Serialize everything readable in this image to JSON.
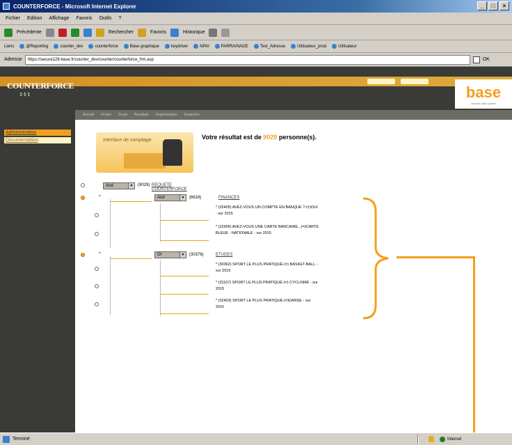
{
  "window": {
    "title": "COUNTERFORCE - Microsoft Internet Explorer"
  },
  "menu": [
    "Fichier",
    "Edition",
    "Affichage",
    "Favoris",
    "Outils",
    "?"
  ],
  "toolbar": {
    "back": "Précédente",
    "search": "Rechercher",
    "favorites": "Favoris",
    "history": "Historique"
  },
  "links": {
    "label": "Liens",
    "items": [
      "@Reporting",
      "counter_dev",
      "counterforce",
      "Base graphique",
      "keydriver",
      "NPAI",
      "PARRAINAGE",
      "Test_Adresse",
      "Utilisateur_prod",
      "Utilisateur"
    ]
  },
  "address": {
    "label": "Adresse",
    "url": "https://secure128-base.fr/counter_dev/counter/counterforce_frm.asp",
    "go": "OK"
  },
  "header": {
    "brand": "COUNTERFORCE",
    "brand_sub": "1·1·1",
    "base_logo": "base",
    "base_tagline": "courrier data system"
  },
  "nav": [
    "Accueil",
    "Fichier",
    "Script",
    "Resultats",
    "Segmentation",
    "Extraction"
  ],
  "sidebar": {
    "items": [
      "Administration",
      "Documentation"
    ]
  },
  "illustration": {
    "label": "Interface de comptage"
  },
  "result": {
    "prefix": "Votre résultat est de",
    "count": "9029",
    "suffix": "personne(s)."
  },
  "tree": {
    "root": {
      "op": "And",
      "count": "(9029)",
      "label": "REQUETE COUNTERFORCE"
    },
    "groups": [
      {
        "op": "And",
        "count": "(6618)",
        "label": "FINANCES",
        "criteria": [
          "* (32405) AVEZ-VOUS UN COMPTE EN BANQUE ?-(=)OUI - sur 2015",
          "* (22905) AVEZ-VOUS UNE CARTE BANCAIRE...(=)CARTE BLEUE - NATIONALE - sur 2015"
        ]
      },
      {
        "op": "Or",
        "count": "(30376)",
        "label": "ETUDES",
        "criteria": [
          "* (30362) SPORT LE PLUS PRATIQUÉ-(=) BASKET-BALL - sur 2015",
          "* (31107) SPORT LE PLUS PRATIQUÉ-(=) CYCLISME - sur 2015",
          "* (32403) SPORT LE PLUS PRATIQUÉ-(=)DANSE - sur 2015"
        ]
      }
    ]
  },
  "status": {
    "text": "Terminé",
    "zone": "Internet"
  },
  "colors": {
    "accent": "#f59e1a",
    "header_dark": "#3a3a36"
  }
}
